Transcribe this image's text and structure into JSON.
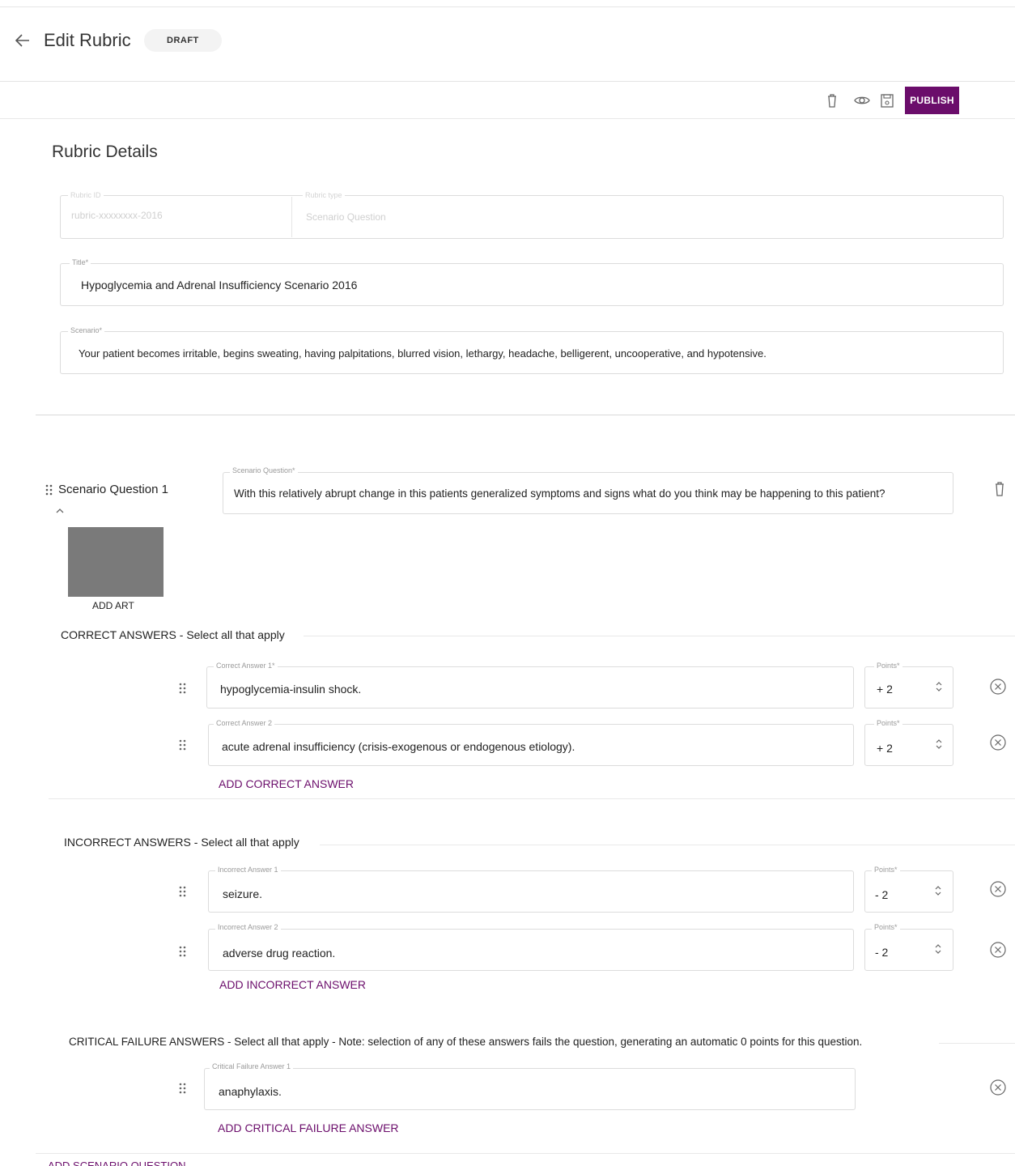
{
  "header": {
    "title": "Edit Rubric",
    "status_badge": "DRAFT"
  },
  "toolbar": {
    "delete_icon": "trash-icon",
    "preview_icon": "eye-icon",
    "save_icon": "save-icon",
    "publish_label": "PUBLISH"
  },
  "details": {
    "section_title": "Rubric Details",
    "id_label": "Rubric ID",
    "id_value": "rubric-xxxxxxxx-2016",
    "type_label": "Rubric type",
    "type_value": "Scenario Question",
    "title_label": "Title*",
    "title_value": "Hypoglycemia and Adrenal Insufficiency Scenario 2016",
    "scenario_label": "Scenario*",
    "scenario_value": "Your patient becomes irritable, begins sweating, having palpitations, blurred vision, lethargy, headache,  belligerent, uncooperative, and hypotensive."
  },
  "question": {
    "label": "Scenario Question 1",
    "field_label": "Scenario Question*",
    "field_value": "With this relatively abrupt change in this patients generalized symptoms and signs what do you think may be happening to this patient?",
    "add_art_label": "ADD ART"
  },
  "correct": {
    "heading": "CORRECT ANSWERS - Select all that apply",
    "answers": [
      {
        "label": "Correct Answer 1*",
        "value": "hypoglycemia-insulin shock.",
        "points_label": "Points*",
        "points": "+ 2"
      },
      {
        "label": "Correct Answer 2",
        "value": "acute adrenal insufficiency (crisis-exogenous or endogenous etiology).",
        "points_label": "Points*",
        "points": "+ 2"
      }
    ],
    "add_label": "ADD CORRECT ANSWER"
  },
  "incorrect": {
    "heading": "INCORRECT ANSWERS - Select all that apply",
    "answers": [
      {
        "label": "Incorrect Answer 1",
        "value": "seizure.",
        "points_label": "Points*",
        "points": "- 2"
      },
      {
        "label": "Incorrect Answer 2",
        "value": "adverse drug reaction.",
        "points_label": "Points*",
        "points": "- 2"
      }
    ],
    "add_label": "ADD INCORRECT ANSWER"
  },
  "critical": {
    "heading": "CRITICAL FAILURE ANSWERS - Select all that apply - Note: selection of any of these answers fails the question, generating an automatic 0 points for this question.",
    "answers": [
      {
        "label": "Critical Failure Answer 1",
        "value": "anaphylaxis."
      }
    ],
    "add_label": "ADD CRITICAL FAILURE ANSWER"
  },
  "footer": {
    "add_question_label": "ADD SCENARIO QUESTION"
  },
  "colors": {
    "accent": "#6b0d6b"
  }
}
